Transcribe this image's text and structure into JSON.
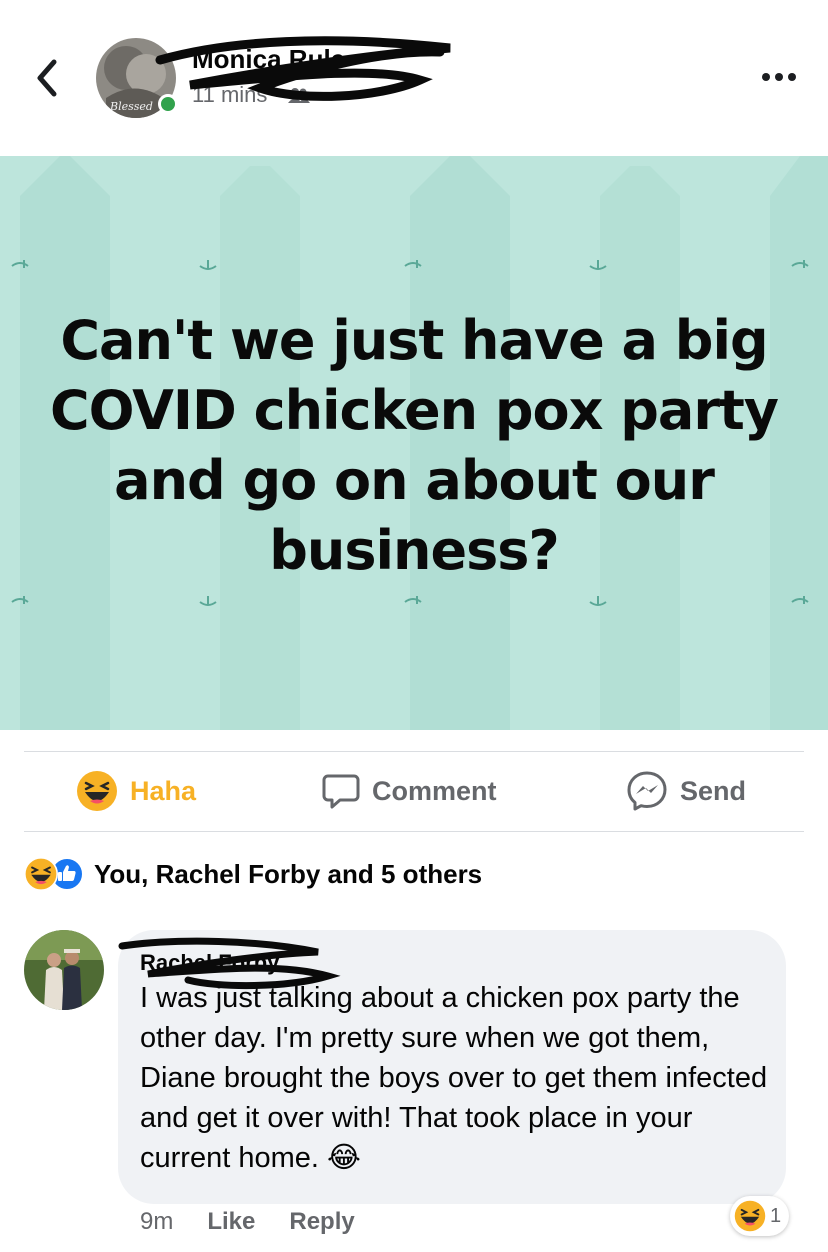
{
  "header": {
    "author_name": "Monica Rule",
    "time": "11 mins",
    "separator": "·",
    "avatar_caption": "Blessed"
  },
  "post": {
    "image_text": "Can't we just have a big COVID chicken pox party and go on about our business?",
    "image_bg_color": "#bde5dc"
  },
  "actions": {
    "haha_label": "Haha",
    "comment_label": "Comment",
    "send_label": "Send"
  },
  "reactions_summary": "You, Rachel Forby and 5 others",
  "comment": {
    "author": "Rachel Forby",
    "text": "I was just talking about a chicken pox party the other day. I'm pretty sure when we got them, Diane brought the boys over to get them infected and get it over with! That took place in your current home. 😂",
    "time": "9m",
    "like_label": "Like",
    "reply_label": "Reply",
    "reaction_count": "1"
  },
  "colors": {
    "haha": "#f7b125",
    "like_blue": "#1877f2",
    "online": "#31a24c",
    "secondary_text": "#65676b"
  }
}
